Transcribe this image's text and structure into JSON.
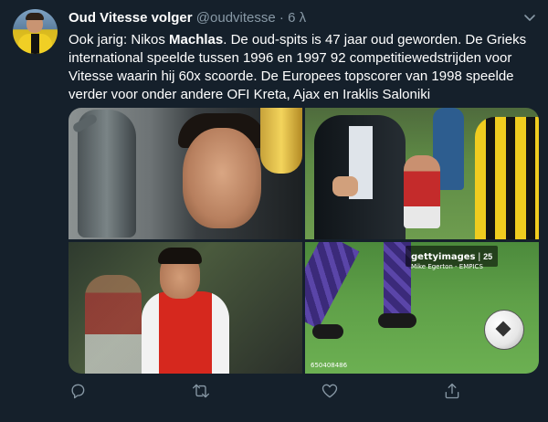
{
  "tweet": {
    "display_name": "Oud Vitesse volger",
    "handle": "@oudvitesse",
    "separator": "·",
    "time": "6 λ",
    "text_part1": "Ook jarig: Nikos ",
    "text_bold": "Machlas",
    "text_part2": ". De oud-spits is 47 jaar oud geworden. De Grieks international speelde tussen 1996 en 1997 92 competitiewedstrijden voor Vitesse waarin hij 60x scoorde. De Europees topscorer van 1998 speelde verder voor onder andere OFI Kreta, Ajax en Iraklis Saloniki"
  },
  "media": {
    "watermark_logo": "gettyimages",
    "watermark_sep": "|",
    "watermark_years": "25",
    "watermark_credit": "Mike Egerton - EMPICS",
    "watermark_id": "650408486"
  },
  "icons": {
    "chevron": "chevron-down-icon",
    "reply": "reply-icon",
    "retweet": "retweet-icon",
    "like": "heart-icon",
    "share": "share-icon"
  },
  "colors": {
    "background": "#15202b",
    "secondary_text": "#8899a6",
    "primary_text": "#ffffff"
  }
}
